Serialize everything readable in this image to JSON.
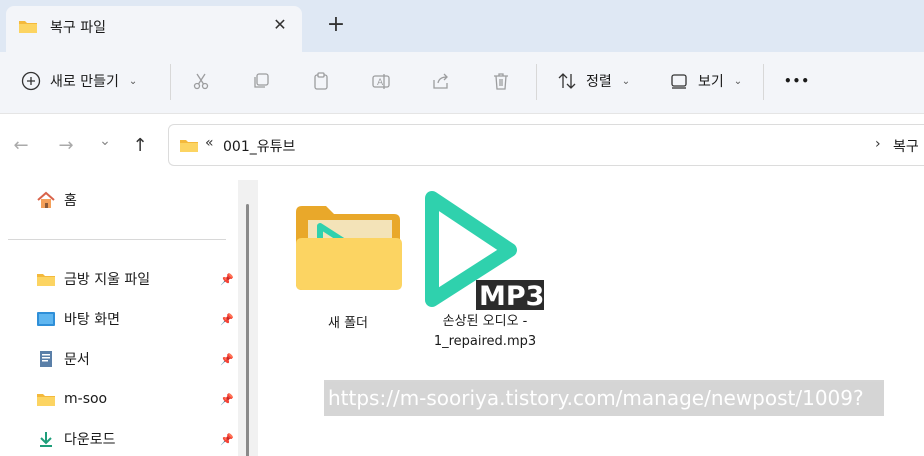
{
  "tab": {
    "title": "복구 파일",
    "close_glyph": "✕",
    "new_tab_glyph": "+"
  },
  "toolbar": {
    "new_label": "새로 만들기",
    "sort_label": "정렬",
    "view_label": "보기",
    "more_glyph": "•••"
  },
  "nav": {
    "back_glyph": "←",
    "forward_glyph": "→",
    "recent_glyph": "⌄",
    "up_glyph": "↑"
  },
  "address": {
    "overflow_glyph": "«",
    "crumb": "001_유튜브",
    "separator": "›",
    "crumb2": "복구"
  },
  "sidebar": {
    "home_label": "홈",
    "items": [
      {
        "label": "금방 지울 파일",
        "icon": "folder-icon"
      },
      {
        "label": "바탕 화면",
        "icon": "desktop-icon"
      },
      {
        "label": "문서",
        "icon": "document-icon"
      },
      {
        "label": "m-soo",
        "icon": "folder-icon"
      },
      {
        "label": "다운로드",
        "icon": "download-icon"
      }
    ]
  },
  "content": {
    "folder_name": "새 폴더",
    "file_name_line1": "손상된 오디오 -",
    "file_name_line2": "1_repaired.mp3",
    "mp3_badge": "MP3",
    "url_watermark": "https://m-sooriya.tistory.com/manage/newpost/1009?"
  },
  "colors": {
    "accent_teal": "#2fd1ad",
    "folder_yellow": "#f7c948",
    "titlebar_bg": "#dfe8f4"
  }
}
